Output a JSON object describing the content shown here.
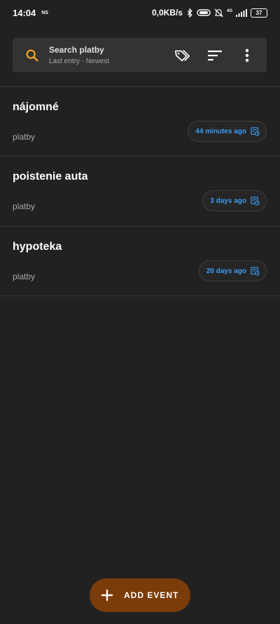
{
  "status_bar": {
    "time": "14:04",
    "carrier_tag": "NS",
    "net_speed": "0,0KB/s",
    "network_type": "4G",
    "battery": "37",
    "icons": [
      "bluetooth-icon",
      "vibrate-icon",
      "mute-icon",
      "signal-icon",
      "battery-icon"
    ]
  },
  "search": {
    "title": "Search platby",
    "subtitle": "Last entry - Newest"
  },
  "toolbar": {
    "icons": [
      "tag-icon",
      "sort-icon",
      "more-vert-icon"
    ]
  },
  "events": [
    {
      "title": "nájomné",
      "category": "platby",
      "time": "44 minutes ago"
    },
    {
      "title": "poistenie auta",
      "category": "platby",
      "time": "3 days ago"
    },
    {
      "title": "hypoteka",
      "category": "platby",
      "time": "20 days ago"
    }
  ],
  "fab": {
    "label": "ADD EVENT"
  },
  "colors": {
    "background": "#212121",
    "search_bg": "#333333",
    "accent_orange": "#f5a623",
    "chip_text": "#3d9bf0",
    "fab_bg": "#7a3c08"
  }
}
